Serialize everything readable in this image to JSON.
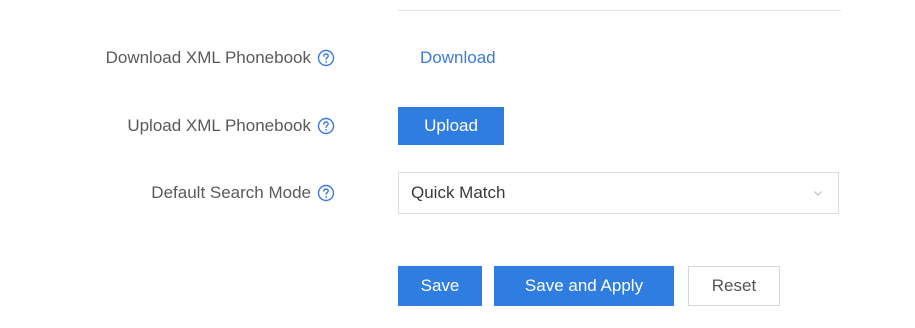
{
  "form": {
    "download": {
      "label": "Download XML Phonebook",
      "action": "Download"
    },
    "upload": {
      "label": "Upload XML Phonebook",
      "action": "Upload"
    },
    "search_mode": {
      "label": "Default Search Mode",
      "value": "Quick Match"
    }
  },
  "actions": {
    "save": "Save",
    "save_apply": "Save and Apply",
    "reset": "Reset"
  },
  "colors": {
    "primary": "#2f7de1",
    "link": "#3b7ad9",
    "label": "#5a5a5a"
  },
  "icons": {
    "help": "question-circle-icon",
    "dropdown": "chevron-down-icon"
  }
}
